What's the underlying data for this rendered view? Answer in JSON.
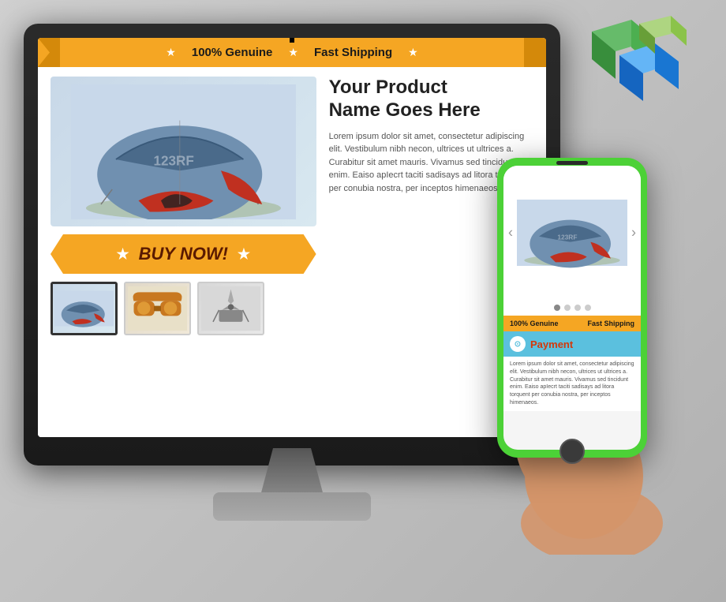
{
  "monitor": {
    "label": "Desktop Monitor"
  },
  "banner": {
    "genuine_label": "100% Genuine",
    "shipping_label": "Fast Shipping",
    "star_char": "★"
  },
  "product": {
    "name_line1": "Your Product",
    "name_line2": "Name Goes Here",
    "description": "Lorem ipsum dolor sit amet, consectetur adipiscing elit. Vestibulum nibh necon, ultrices ut ultrices a. Curabitur sit amet mauris. Vivamus sed tincidunt enim. Eaiso apIecrt taciti sadisays ad litora torquent per conubia nostra, per inceptos himenaeos.",
    "buy_now_label": "BUY NOW!",
    "watermark": "123RF"
  },
  "thumbnails": [
    {
      "id": "thumb-tent",
      "active": true,
      "label": "Tent thumbnail"
    },
    {
      "id": "thumb-goggles",
      "active": false,
      "label": "Goggles thumbnail"
    },
    {
      "id": "thumb-stove",
      "active": false,
      "label": "Stove thumbnail"
    }
  ],
  "phone": {
    "genuine_label": "100% Genuine",
    "shipping_label": "Fast Shipping",
    "payment_label": "Payment",
    "payment_icon": "⓪",
    "lorem_text": "Lorem ipsum dolor sit amet, consectetur adipiscing elit. Vestibulum nibh necon, ultrices ut ultrices a. Curabitur sit amet mauris. Vivamus sed tincidunt enim. Eaiso apIecrt taciti sadisays ad litora torquent per conubia nostra, per inceptos himenaeos.",
    "arrow_left": "‹",
    "arrow_right": "›",
    "dots": [
      true,
      false,
      false,
      false
    ]
  },
  "deco": {
    "box_green": "#4caf50",
    "box_blue": "#2196f3",
    "box_orange": "#ff9800"
  }
}
